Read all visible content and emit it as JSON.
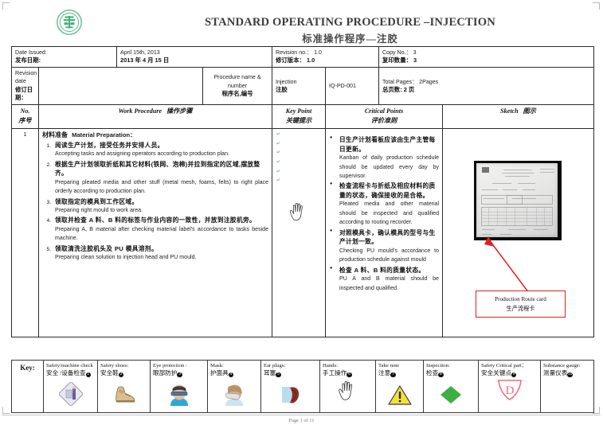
{
  "header": {
    "logo_alt": "company-logo",
    "title_en": "STANDARD OPERATING PROCEDURE –INJECTION",
    "title_cn": "标准操作程序—注胶"
  },
  "info": {
    "date_issued_en": "Date Issued:",
    "date_issued_cn": "发布日期:",
    "date_value_en": "April 15th, 2013",
    "date_value_cn": "2013 年 4 月 15 日",
    "revision_no_en": "Revision no.：   1.0",
    "revision_no_cn": "修订版本：  1.0",
    "copy_no_en": "Copy No.：   3",
    "copy_no_cn": "复印数量：  3",
    "revision_date_en1": "Revision",
    "revision_date_en2": "date",
    "revision_date_cn": "修订日期：",
    "revision_date_value": "",
    "procedure_name_en": "Procedure name & number",
    "procedure_name_cn": "程序名,编号",
    "procedure_value_en": "Injection",
    "procedure_value_cn": "注胶",
    "procedure_number": "IQ-PD-001",
    "total_pages_en": "Total Pages：   2Pages",
    "total_pages_cn": "总页数: 2 页"
  },
  "columns": {
    "no_en": "No.",
    "no_cn": "序号",
    "work_procedure_en": "Work Procedure",
    "work_procedure_cn": "操作步骤",
    "key_point_en": "Key Point",
    "key_point_cn": "关键提示",
    "critical_points_en": "Critical Points",
    "critical_points_cn": "评价准则",
    "sketch_en": "Sketch",
    "sketch_cn": "图示"
  },
  "row": {
    "no": "1",
    "section_title_cn": "材料准备",
    "section_title_en": "Material Preparation：",
    "steps": [
      {
        "cn": "阅读生产计划，接受任务并安排人员。",
        "en": "Accepting tasks and assigning operators according to production plan."
      },
      {
        "cn": "根据生产计划领取折纸和其它材料(铁网、泡棉)并拉到指定的区域,摆放整齐。",
        "en": "Preparing pleated media and other stuff (metal mesh, foams, felts) to right place orderly according to production plan."
      },
      {
        "cn": "领取指定的模具到工作区域。",
        "en": "Preparing right mould to work area."
      },
      {
        "cn": "领取并检查 A 料、B 料的标签与作业内容的一致性，并放到注胶机旁。",
        "en": "Preparing A, B material after checking material label's accordance to tasks beside machine."
      },
      {
        "cn": "领取清洗注胶机头及 PU 模具溶剂。",
        "en": "Preparing clean solution to injection head and PU mould."
      }
    ],
    "critical_points": [
      {
        "cn": "日生产计划看板应该由生产主管每日更新。",
        "en": "Kanban of daily production schedule should be updated every day by supervisor."
      },
      {
        "cn": "检查流程卡与折纸及相应材料的质量的状态，确保接收的是合格。",
        "en": "Pleated media and other material should be inspected and qualified according to routing recorder."
      },
      {
        "cn": "对照模具卡，确认模具的型号与生产计划一致。",
        "en": "Checking PU mould's accordance to production schedule against mould"
      },
      {
        "cn": "检查 A 料、B 料的质量状态。",
        "en": "PU A and B material should be inspected and qualified."
      }
    ],
    "key_point_icon": "hand-icon",
    "sketch": {
      "photo_alt": "production-route-card-photo",
      "callout_en": "Production Route card",
      "callout_cn": "生产流程卡",
      "callout_border_color": "#e02020",
      "arrow_color": "#e02020"
    }
  },
  "legend": {
    "key_label": "Key:",
    "items": [
      {
        "en": "Safety/machine check",
        "cn": "安全 /设备检查",
        "num": "1",
        "icon": "safety-machine-check-icon"
      },
      {
        "en": "Safety shoes:",
        "cn": "安全鞋",
        "num": "2",
        "icon": "safety-shoes-icon"
      },
      {
        "en": "Eye protection :",
        "cn": "眼部防护",
        "num": "3",
        "icon": "eye-protection-icon"
      },
      {
        "en": "Mask:",
        "cn": "护面具",
        "num": "4",
        "icon": "mask-icon"
      },
      {
        "en": "Ear plugs:",
        "cn": "耳塞",
        "num": "5",
        "icon": "ear-plugs-icon"
      },
      {
        "en": "Hands:",
        "cn": "手工操作",
        "num": "6",
        "icon": "hands-icon"
      },
      {
        "en": "Take note",
        "cn": "注意",
        "num": "7",
        "icon": "warning-triangle-icon"
      },
      {
        "en": "Inspection:",
        "cn": "检查",
        "num": "8",
        "icon": "green-diamond-icon"
      },
      {
        "en": "Safety Critical    part：",
        "cn": "安全关键点",
        "num": "9",
        "icon": "safety-critical-d-icon"
      },
      {
        "en": "Substance gauge:",
        "cn": "测量仪表",
        "num": "10",
        "icon": "substance-gauge-icon"
      }
    ]
  },
  "footer": {
    "page_text": "Page 1 of 11"
  }
}
